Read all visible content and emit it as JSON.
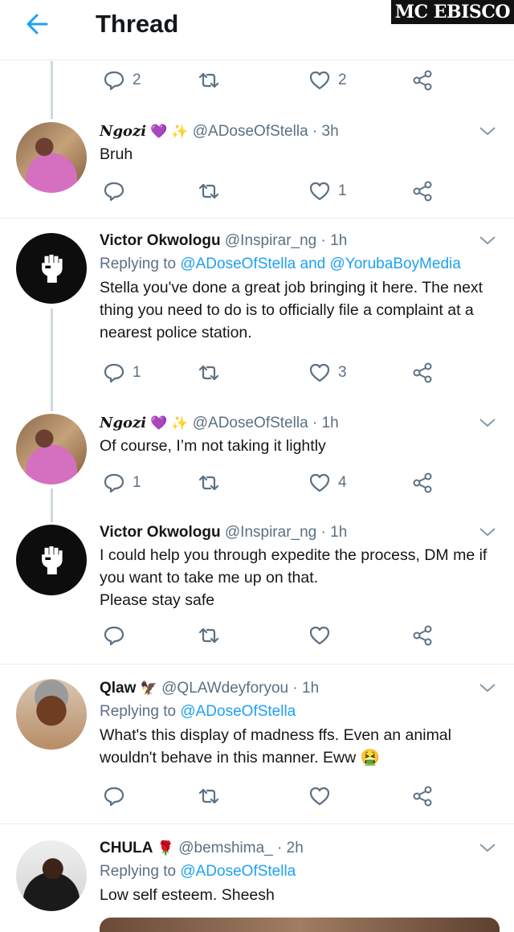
{
  "header": {
    "title": "Thread",
    "watermark": "MC EBISCO"
  },
  "colors": {
    "accent": "#1da1f2",
    "muted": "#5b7083",
    "text": "#14171a"
  },
  "top_actions": {
    "replies": "2",
    "retweets": "",
    "likes": "2"
  },
  "tweets": [
    {
      "name": "Ngozi",
      "badges": "💜 ✨",
      "handle": "@ADoseOfStella",
      "time": "3h",
      "replying_prefix": "",
      "replying_targets": "",
      "text": "Bruh",
      "replies": "",
      "retweets": "",
      "likes": "1"
    },
    {
      "name": "Victor Okwologu",
      "badges": "",
      "handle": "@Inspirar_ng",
      "time": "1h",
      "replying_prefix": "Replying to",
      "replying_targets": "@ADoseOfStella and @YorubaBoyMedia",
      "text": "Stella you've done a great job bringing it here. The next thing you need to do is to officially file a complaint at a nearest police station.",
      "replies": "1",
      "retweets": "",
      "likes": "3"
    },
    {
      "name": "Ngozi",
      "badges": "💜 ✨",
      "handle": "@ADoseOfStella",
      "time": "1h",
      "replying_prefix": "",
      "replying_targets": "",
      "text": "Of course, I’m not taking it lightly",
      "replies": "1",
      "retweets": "",
      "likes": "4"
    },
    {
      "name": "Victor Okwologu",
      "badges": "",
      "handle": "@Inspirar_ng",
      "time": "1h",
      "replying_prefix": "",
      "replying_targets": "",
      "text_lines": [
        "I could help you through expedite the process, DM me if you want to take me up on that.",
        "Please stay safe"
      ],
      "replies": "",
      "retweets": "",
      "likes": ""
    },
    {
      "name": "Qlaw",
      "badges": "🦅",
      "handle": "@QLAWdeyforyou",
      "time": "1h",
      "replying_prefix": "Replying to",
      "replying_targets": "@ADoseOfStella",
      "text": "What's this display of madness ffs. Even an animal wouldn't behave in this manner. Eww 🤮",
      "replies": "",
      "retweets": "",
      "likes": ""
    },
    {
      "name": "CHULA",
      "badges": "🌹",
      "handle": "@bemshima_",
      "time": "2h",
      "replying_prefix": "Replying to",
      "replying_targets": "@ADoseOfStella",
      "text": "Low self esteem. Sheesh"
    }
  ],
  "separator": "·"
}
